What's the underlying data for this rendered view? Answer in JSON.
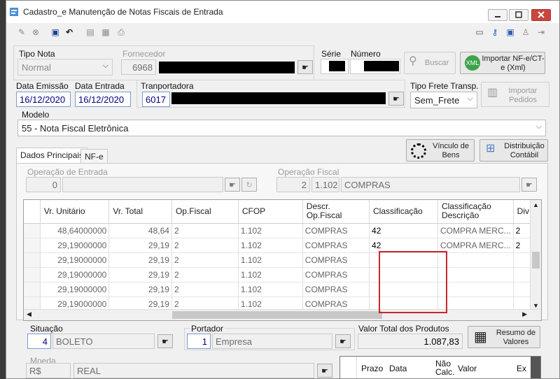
{
  "window": {
    "title": "Cadastro_e Manutenção de Notas Fiscais de Entrada"
  },
  "header": {
    "tipo_nota_label": "Tipo Nota",
    "tipo_nota_value": "Normal",
    "fornecedor_label": "Fornecedor",
    "fornecedor_code": "6968",
    "serie_label": "Série",
    "numero_label": "Número",
    "buscar_label": "Buscar",
    "importar_label": "Importar NF-e/CT-e (Xml)",
    "data_emissao_label": "Data Emissão",
    "data_emissao_value": "16/12/2020",
    "data_entrada_label": "Data Entrada",
    "data_entrada_value": "16/12/2020",
    "transportadora_label": "Tranportadora",
    "transportadora_code": "6017",
    "tipo_frete_label": "Tipo Frete Transp.",
    "tipo_frete_value": "Sem_Frete",
    "importar_pedidos_label": "Importar Pedidos",
    "modelo_label": "Modelo",
    "modelo_value": "55 - Nota Fiscal Eletrônica"
  },
  "tabs": [
    {
      "label": "Dados Principais"
    },
    {
      "label": "NF-e"
    }
  ],
  "actions": {
    "vinculo_label": "Vínculo de Bens",
    "distribuicao_label": "Distribuição Contábil"
  },
  "operacao_entrada": {
    "label": "Operação de Entrada",
    "code": "0"
  },
  "operacao_fiscal": {
    "label": "Operação Fiscal",
    "code": "2",
    "cfop": "1.102",
    "desc": "COMPRAS"
  },
  "grid": {
    "columns": [
      "Vr. Unitário",
      "Vr. Total",
      "Op.Fiscal",
      "CFOP",
      "Descr. Op.Fiscal",
      "Classificação",
      "Classificação Descrição",
      "Div"
    ],
    "rows": [
      [
        "48,64000000",
        "48,64",
        "2",
        "1.102",
        "COMPRAS",
        "42",
        "COMPRA MERC...",
        "2"
      ],
      [
        "29,19000000",
        "29,19",
        "2",
        "1.102",
        "COMPRAS",
        "42",
        "COMPRA MERC...",
        "2"
      ],
      [
        "29,19000000",
        "29,19",
        "2",
        "1.102",
        "COMPRAS",
        "",
        "",
        ""
      ],
      [
        "29,19000000",
        "29,19",
        "2",
        "1.102",
        "COMPRAS",
        "",
        "",
        ""
      ],
      [
        "29,19000000",
        "29,19",
        "2",
        "1.102",
        "COMPRAS",
        "",
        "",
        ""
      ],
      [
        "29,19000000",
        "29,19",
        "2",
        "1.102",
        "COMPRAS",
        "",
        "",
        ""
      ]
    ]
  },
  "footer": {
    "situacao_label": "Situação",
    "situacao_code": "4",
    "situacao_desc": "BOLETO",
    "portador_label": "Portador",
    "portador_code": "1",
    "portador_desc": "Empresa",
    "valor_total_label": "Valor Total dos Produtos",
    "valor_total_value": "1.087,83",
    "resumo_label": "Resumo de Valores",
    "moeda_label": "Moeda",
    "moeda_code": "R$",
    "moeda_desc": "REAL",
    "parcelas_columns": [
      "Prazo",
      "Data",
      "Não Calc.",
      "Valor",
      "Ex"
    ]
  },
  "colors": {
    "accent": "#7a9cd3",
    "highlight_box": "#c8262e",
    "field_text": "#000080"
  }
}
